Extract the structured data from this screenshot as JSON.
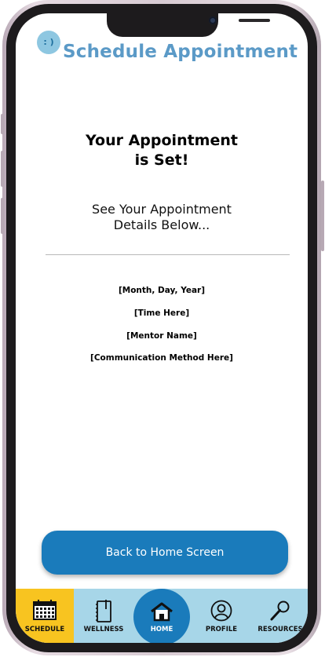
{
  "header": {
    "logo_text": ": )",
    "title": "Schedule Appointment"
  },
  "confirmation": {
    "heading_line1": "Your Appointment",
    "heading_line2": "is Set!",
    "sub_line1": "See Your Appointment",
    "sub_line2": "Details Below..."
  },
  "details": {
    "date": "[Month, Day, Year]",
    "time": "[Time Here]",
    "mentor": "[Mentor Name]",
    "method": "[Communication Method Here]"
  },
  "actions": {
    "back_home_label": "Back to Home Screen"
  },
  "nav": {
    "schedule": "SCHEDULE",
    "wellness": "WELLNESS",
    "home": "HOME",
    "profile": "PROFILE",
    "resources": "RESOURCES"
  },
  "colors": {
    "accent_blue": "#1a7bbb",
    "title_blue": "#5b9ac7",
    "nav_bg": "#a7d6e8",
    "schedule_active": "#f8c420"
  },
  "icons": {
    "schedule": "calendar-icon",
    "wellness": "notebook-icon",
    "home": "house-icon",
    "profile": "user-circle-icon",
    "resources": "magnifier-icon"
  }
}
